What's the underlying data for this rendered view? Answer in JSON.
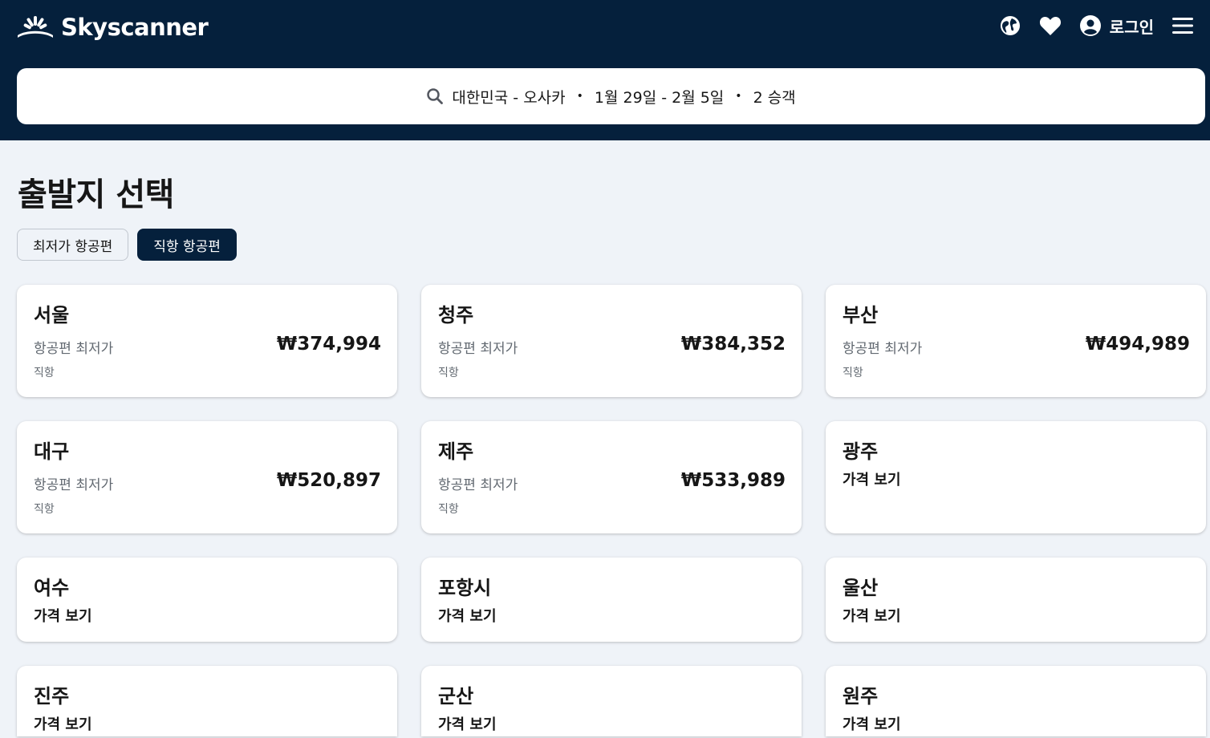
{
  "header": {
    "brand": "Skyscanner",
    "login_label": "로그인",
    "colors": {
      "background": "#05203c",
      "foreground": "#ffffff"
    },
    "icons": [
      "globe-icon",
      "heart-icon",
      "account-icon",
      "menu-icon"
    ]
  },
  "search": {
    "route": "대한민국 - 오사카",
    "dates": "1월 29일 - 2월 5일",
    "passengers": "2 승객",
    "separator": "•",
    "icon": "search-icon"
  },
  "page": {
    "title": "출발지 선택"
  },
  "filters": [
    {
      "label": "최저가 항공편",
      "active": false
    },
    {
      "label": "직항 항공편",
      "active": true
    }
  ],
  "cards": [
    {
      "city": "서울",
      "subtitle": "항공편 최저가",
      "price": "₩374,994",
      "tag": "직항"
    },
    {
      "city": "청주",
      "subtitle": "항공편 최저가",
      "price": "₩384,352",
      "tag": "직항"
    },
    {
      "city": "부산",
      "subtitle": "항공편 최저가",
      "price": "₩494,989",
      "tag": "직항"
    },
    {
      "city": "대구",
      "subtitle": "항공편 최저가",
      "price": "₩520,897",
      "tag": "직항"
    },
    {
      "city": "제주",
      "subtitle": "항공편 최저가",
      "price": "₩533,989",
      "tag": "직항"
    },
    {
      "city": "광주",
      "see_prices": "가격 보기"
    },
    {
      "city": "여수",
      "see_prices": "가격 보기"
    },
    {
      "city": "포항시",
      "see_prices": "가격 보기"
    },
    {
      "city": "울산",
      "see_prices": "가격 보기"
    },
    {
      "city": "진주",
      "see_prices": "가격 보기"
    },
    {
      "city": "군산",
      "see_prices": "가격 보기"
    },
    {
      "city": "원주",
      "see_prices": "가격 보기"
    }
  ]
}
